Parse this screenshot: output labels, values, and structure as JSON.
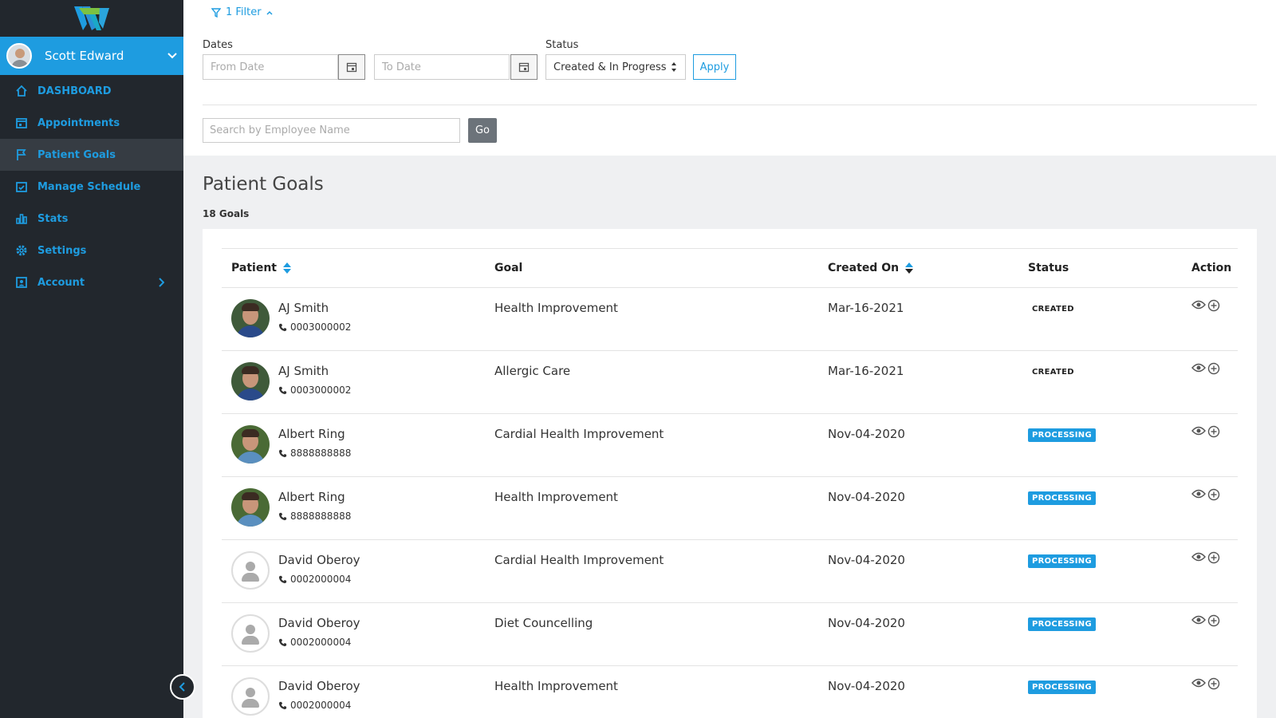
{
  "sidebar": {
    "user_name": "Scott Edward",
    "items": [
      {
        "label": "DASHBOARD",
        "icon": "home-icon"
      },
      {
        "label": "Appointments",
        "icon": "calendar-icon"
      },
      {
        "label": "Patient Goals",
        "icon": "flag-icon"
      },
      {
        "label": "Manage Schedule",
        "icon": "calendar-check-icon"
      },
      {
        "label": "Stats",
        "icon": "bar-chart-icon"
      },
      {
        "label": "Settings",
        "icon": "gear-icon"
      },
      {
        "label": "Account",
        "icon": "account-icon"
      }
    ]
  },
  "filter": {
    "toggle_label": "1 Filter",
    "dates_label": "Dates",
    "from_placeholder": "From Date",
    "to_placeholder": "To Date",
    "status_label": "Status",
    "status_value": "Created & In Progress",
    "apply_label": "Apply",
    "search_placeholder": "Search by Employee Name",
    "go_label": "Go"
  },
  "page": {
    "title": "Patient Goals",
    "count": "18 Goals"
  },
  "table": {
    "headers": {
      "patient": "Patient",
      "goal": "Goal",
      "created_on": "Created On",
      "status": "Status",
      "action": "Action"
    },
    "rows": [
      {
        "name": "AJ Smith",
        "phone": "0003000002",
        "goal": "Health Improvement",
        "created": "Mar-16-2021",
        "status": "CREATED"
      },
      {
        "name": "AJ Smith",
        "phone": "0003000002",
        "goal": "Allergic Care",
        "created": "Mar-16-2021",
        "status": "CREATED"
      },
      {
        "name": "Albert Ring",
        "phone": "8888888888",
        "goal": "Cardial Health Improvement",
        "created": "Nov-04-2020",
        "status": "PROCESSING"
      },
      {
        "name": "Albert Ring",
        "phone": "8888888888",
        "goal": "Health Improvement",
        "created": "Nov-04-2020",
        "status": "PROCESSING"
      },
      {
        "name": "David Oberoy",
        "phone": "0002000004",
        "goal": "Cardial Health Improvement",
        "created": "Nov-04-2020",
        "status": "PROCESSING"
      },
      {
        "name": "David Oberoy",
        "phone": "0002000004",
        "goal": "Diet Councelling",
        "created": "Nov-04-2020",
        "status": "PROCESSING"
      },
      {
        "name": "David Oberoy",
        "phone": "0002000004",
        "goal": "Health Improvement",
        "created": "Nov-04-2020",
        "status": "PROCESSING"
      }
    ]
  },
  "colors": {
    "accent": "#1e9ce0",
    "sidebar_bg": "#22272d",
    "logo_green": "#7cc242"
  }
}
